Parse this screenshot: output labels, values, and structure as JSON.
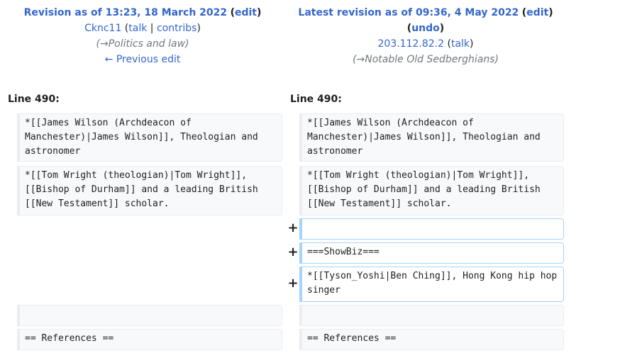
{
  "left": {
    "revision_title": "Revision as of 13:23, 18 March 2022",
    "edit": "edit",
    "user": "Cknc11",
    "talk": "talk",
    "contribs": "contribs",
    "summary_arrow": "→",
    "summary_section": "Politics and law",
    "prev_edit": "← Previous edit",
    "line_label": "Line 490:"
  },
  "right": {
    "revision_title": "Latest revision as of 09:36, 4 May 2022",
    "edit": "edit",
    "undo": "undo",
    "user": "203.112.82.2",
    "talk": "talk",
    "summary_arrow": "→",
    "summary_section": "Notable Old Sedberghians",
    "line_label": "Line 490:"
  },
  "context": {
    "row1": "*[[James Wilson (Archdeacon of Manchester)|James Wilson]], Theologian and astronomer",
    "row2": "*[[Tom Wright (theologian)|Tom Wright]], [[Bishop of Durham]] and a leading British [[New Testament]] scholar.",
    "row_blank": "",
    "row_refs": "== References =="
  },
  "added": {
    "marker": "+",
    "line1": "",
    "line2": "===ShowBiz===",
    "line3": "*[[Tyson_Yoshi|Ben Ching]], Hong Kong hip hop singer"
  }
}
